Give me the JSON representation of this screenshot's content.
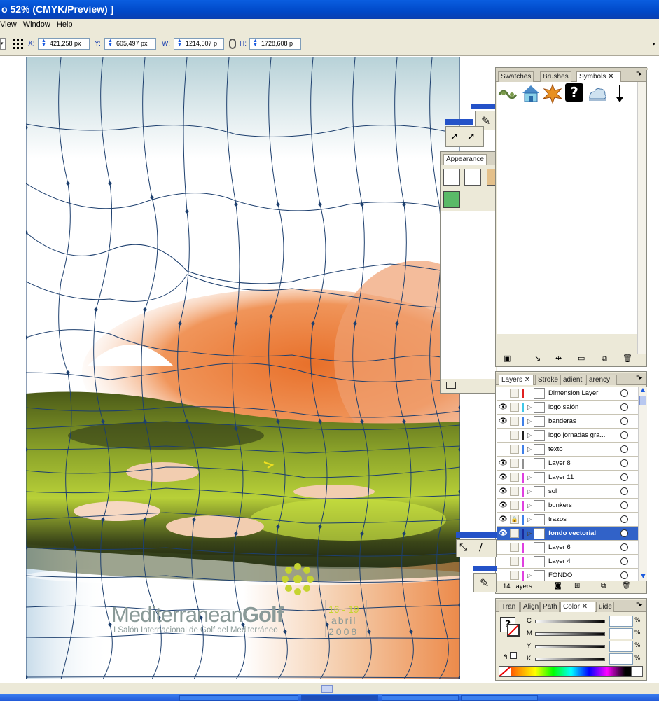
{
  "window": {
    "title": "o 52% (CMYK/Preview) ]"
  },
  "menu": {
    "items": [
      "View",
      "Window",
      "Help"
    ]
  },
  "control_bar": {
    "x_label": "X:",
    "x_value": "421,258 px",
    "y_label": "Y:",
    "y_value": "605,497 px",
    "w_label": "W:",
    "w_value": "1214,507 p",
    "h_label": "H:",
    "h_value": "1728,608 p"
  },
  "artwork": {
    "brand_light": "Mediterranean",
    "brand_bold": "Golf",
    "dates": "16 - 19",
    "month": "abril",
    "year": "2008",
    "subtitle": "I Salón Internacional de Golf del Mediterráneo"
  },
  "symbols_panel": {
    "tabs": [
      "Swatches",
      "Brushes",
      "Symbols"
    ],
    "active_tab": "Symbols",
    "symbols": [
      "rope-symbol",
      "house-symbol",
      "leaf-symbol",
      "question-symbol",
      "cloud-symbol",
      "arrow-symbol"
    ]
  },
  "appearance_panel": {
    "tab": "Appearance"
  },
  "layers_panel": {
    "tabs": [
      "Layers",
      "Stroke",
      "adient",
      "arency"
    ],
    "layers": [
      {
        "name": "Dimension Layer",
        "visible": false,
        "locked": false,
        "color": "#e02020",
        "expandable": false
      },
      {
        "name": "logo salón",
        "visible": true,
        "locked": false,
        "color": "#40c8e8",
        "expandable": true
      },
      {
        "name": "banderas",
        "visible": true,
        "locked": false,
        "color": "#4080e8",
        "expandable": true
      },
      {
        "name": "logo jornadas gra...",
        "visible": false,
        "locked": false,
        "color": "#202020",
        "expandable": true
      },
      {
        "name": "texto",
        "visible": false,
        "locked": false,
        "color": "#4080e8",
        "expandable": true
      },
      {
        "name": "Layer 8",
        "visible": true,
        "locked": false,
        "color": "#909090",
        "expandable": false
      },
      {
        "name": "Layer 11",
        "visible": true,
        "locked": false,
        "color": "#e040e0",
        "expandable": true
      },
      {
        "name": "sol",
        "visible": true,
        "locked": false,
        "color": "#e040e0",
        "expandable": true
      },
      {
        "name": "bunkers",
        "visible": true,
        "locked": false,
        "color": "#e040e0",
        "expandable": true
      },
      {
        "name": "trazos",
        "visible": true,
        "locked": true,
        "color": "#4080e8",
        "expandable": true
      },
      {
        "name": "fondo vectorial",
        "visible": true,
        "locked": false,
        "color": "#1a2a9a",
        "expandable": true,
        "selected": true
      },
      {
        "name": "Layer 6",
        "visible": false,
        "locked": false,
        "color": "#e040e0",
        "expandable": false
      },
      {
        "name": "Layer 4",
        "visible": false,
        "locked": false,
        "color": "#e040e0",
        "expandable": false
      },
      {
        "name": "FONDO",
        "visible": false,
        "locked": false,
        "color": "#e040e0",
        "expandable": true
      }
    ],
    "count_label": "14 Layers"
  },
  "color_panel": {
    "tabs": [
      "Tran",
      "Align",
      "Path",
      "Color",
      "uide"
    ],
    "active_tab": "Color",
    "channels": [
      {
        "label": "C",
        "unit": "%"
      },
      {
        "label": "M",
        "unit": "%"
      },
      {
        "label": "Y",
        "unit": "%"
      },
      {
        "label": "K",
        "unit": "%"
      }
    ]
  }
}
